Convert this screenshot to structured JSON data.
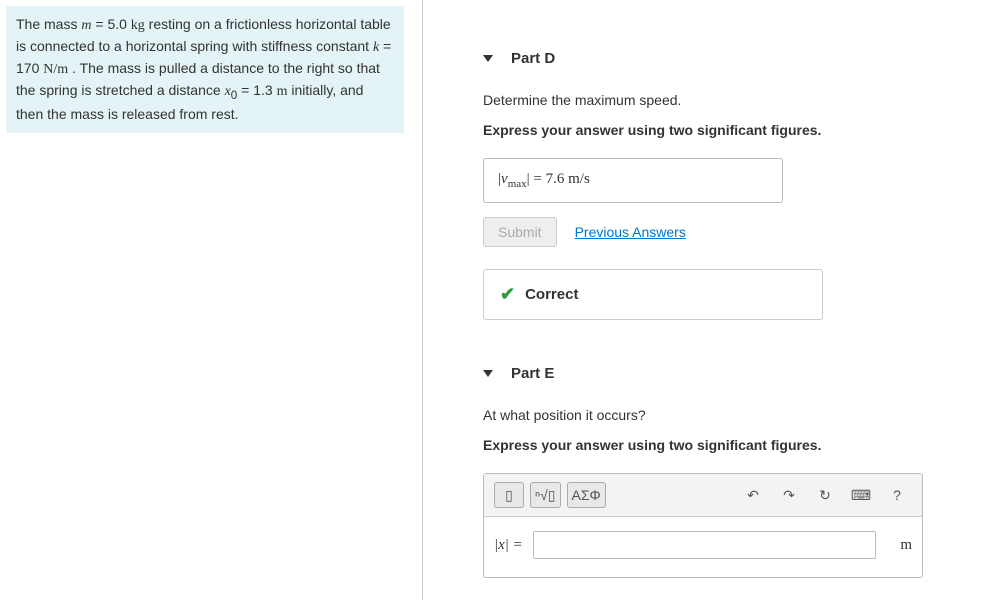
{
  "problem": {
    "html": "The mass <span class='math-var'>m</span> = 5.0 <span class='math-unit'>kg</span> resting on a frictionless horizontal table is connected to a horizontal spring with stiffness constant <span class='math-var'>k</span> = 170 <span class='math-unit'>N/m</span> . The mass is pulled a distance to the right so that the spring is stretched a distance <span class='math-var'>x</span><sub>0</sub> = 1.3 <span class='math-unit'>m</span> initially, and then the mass is released from rest."
  },
  "partD": {
    "title": "Part D",
    "prompt": "Determine the maximum speed.",
    "instruct": "Express your answer using two significant figures.",
    "answer_prefix": "|v",
    "answer_sub": "max",
    "answer_suffix": "| = 7.6  m/s",
    "submit": "Submit",
    "prev": "Previous Answers",
    "feedback": "Correct"
  },
  "partE": {
    "title": "Part E",
    "prompt": "At what position it occurs?",
    "instruct": "Express your answer using two significant figures.",
    "var_label": "|x| =",
    "unit": "m",
    "toolbar": {
      "templates": "▯",
      "radical": "ⁿ√▯",
      "greek": "ΑΣΦ",
      "undo": "↶",
      "redo": "↷",
      "reset": "↻",
      "keyboard": "⌨",
      "help": "?"
    }
  }
}
